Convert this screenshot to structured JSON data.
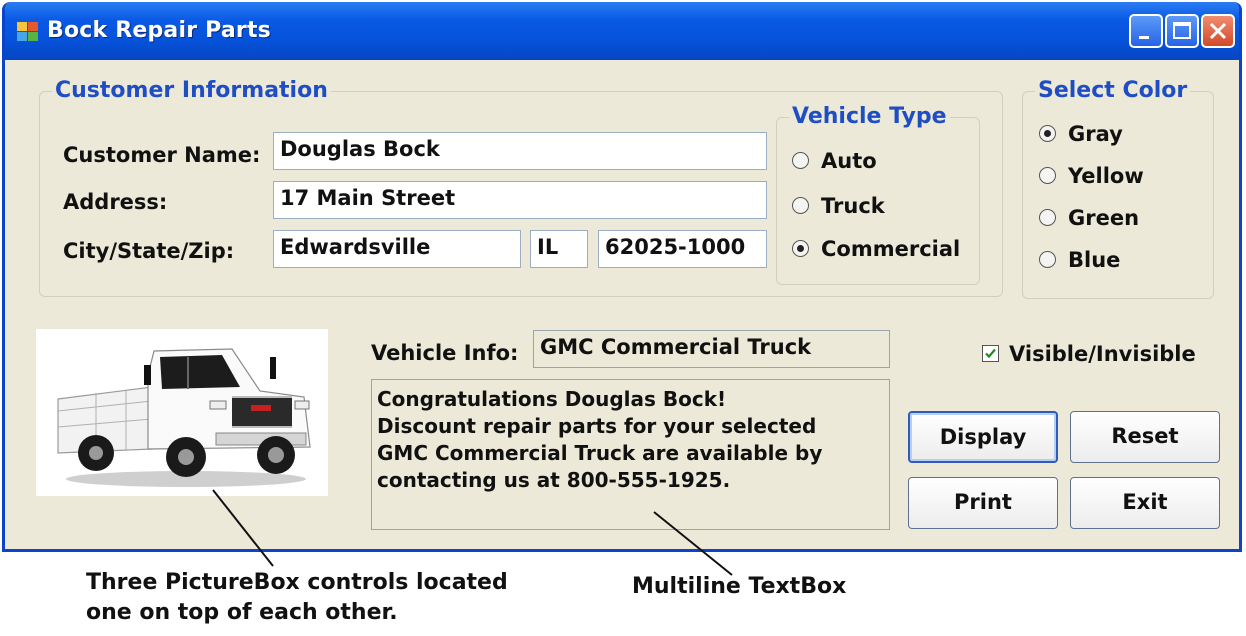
{
  "window": {
    "title": "Bock Repair Parts"
  },
  "customer_group": {
    "title": "Customer Information",
    "name_label": "Customer Name:",
    "name_value": "Douglas Bock",
    "address_label": "Address:",
    "address_value": "17 Main Street",
    "csz_label": "City/State/Zip:",
    "city_value": "Edwardsville",
    "state_value": "IL",
    "zip_value": "62025-1000"
  },
  "vehicle_type": {
    "title": "Vehicle Type",
    "options": [
      "Auto",
      "Truck",
      "Commercial"
    ],
    "selected": "Commercial"
  },
  "select_color": {
    "title": "Select Color",
    "options": [
      "Gray",
      "Yellow",
      "Green",
      "Blue"
    ],
    "selected": "Gray"
  },
  "vehicle_info": {
    "label": "Vehicle Info:",
    "value": "GMC Commercial Truck"
  },
  "message": {
    "lines": [
      "Congratulations Douglas Bock!",
      "Discount repair parts for your selected",
      "GMC Commercial Truck are available by",
      "contacting us at 800-555-1925."
    ]
  },
  "visible_checkbox": {
    "label": "Visible/Invisible",
    "checked": true
  },
  "buttons": {
    "display": "Display",
    "reset": "Reset",
    "print": "Print",
    "exit": "Exit"
  },
  "annotations": {
    "picturebox": [
      "Three PictureBox controls located",
      "one on top of each other."
    ],
    "textbox": "Multiline TextBox"
  },
  "icons": {
    "app": "app-icon",
    "minimize": "minimize-icon",
    "maximize": "maximize-icon",
    "close": "close-icon",
    "truck": "truck-image"
  },
  "colors": {
    "titlebar": "#0a5ae6",
    "group_title": "#1f4ec4",
    "client": "#ece9d8"
  }
}
